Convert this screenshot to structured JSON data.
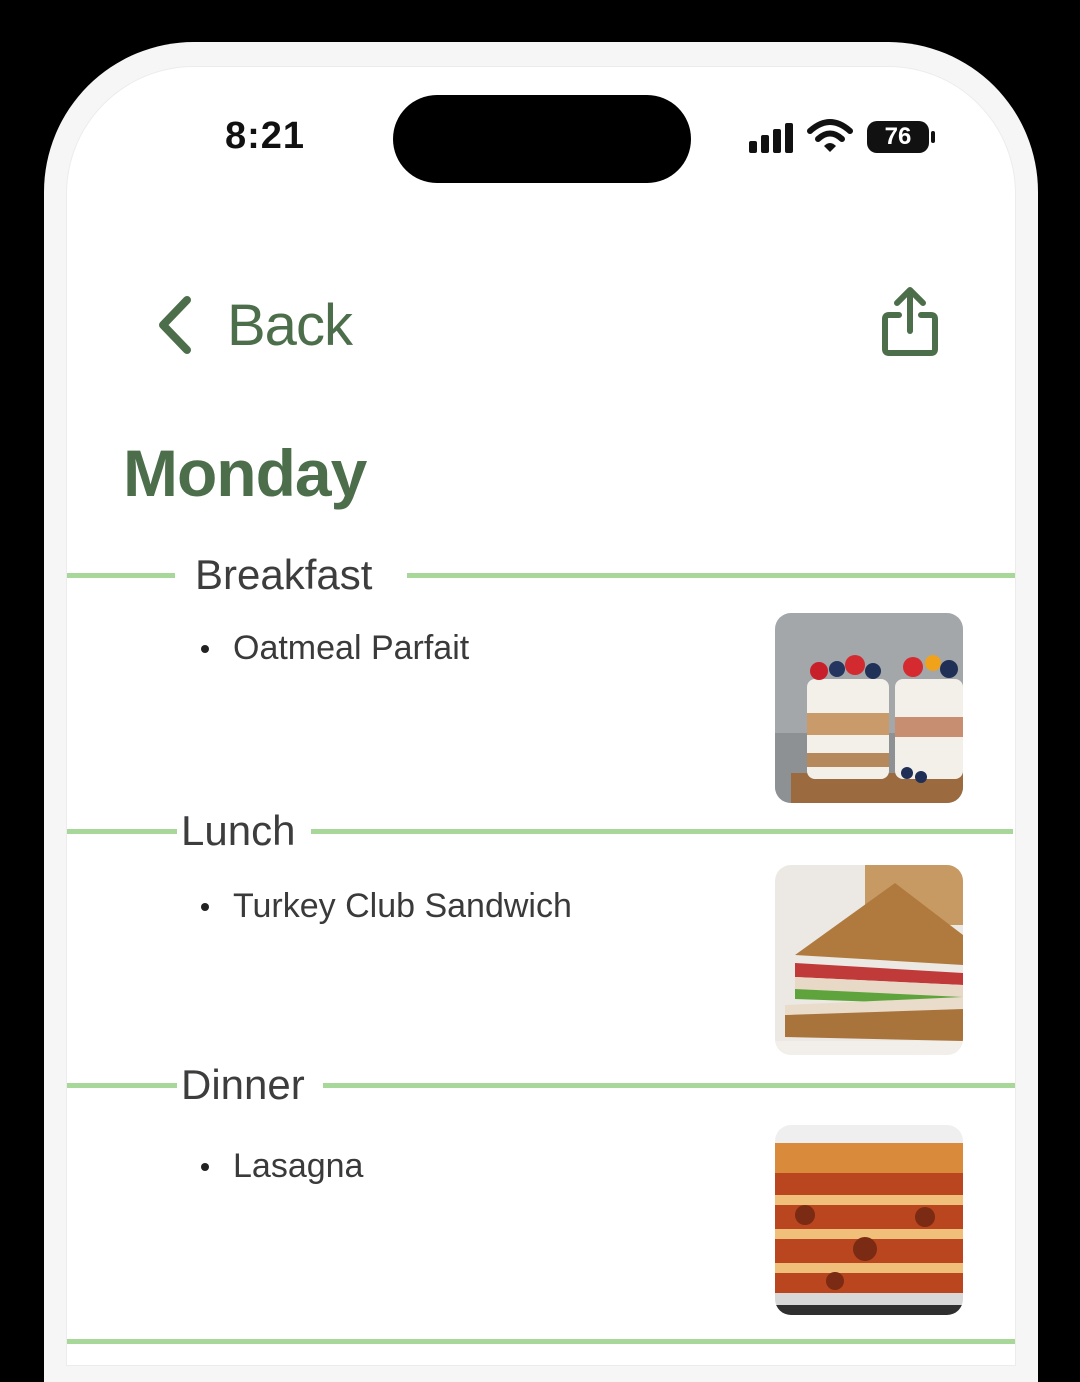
{
  "status_bar": {
    "time": "8:21",
    "battery": "76"
  },
  "nav": {
    "back_label": "Back",
    "back_icon": "chevron-left-icon",
    "share_icon": "share-icon",
    "accent_color": "#4c6e4b"
  },
  "page": {
    "title": "Monday"
  },
  "meals": [
    {
      "name": "Breakfast",
      "item": "Oatmeal Parfait",
      "image": "oatmeal-parfait"
    },
    {
      "name": "Lunch",
      "item": "Turkey Club Sandwich",
      "image": "turkey-club-sandwich"
    },
    {
      "name": "Dinner",
      "item": "Lasagna",
      "image": "lasagna"
    }
  ],
  "divider_color": "#a8d79a"
}
